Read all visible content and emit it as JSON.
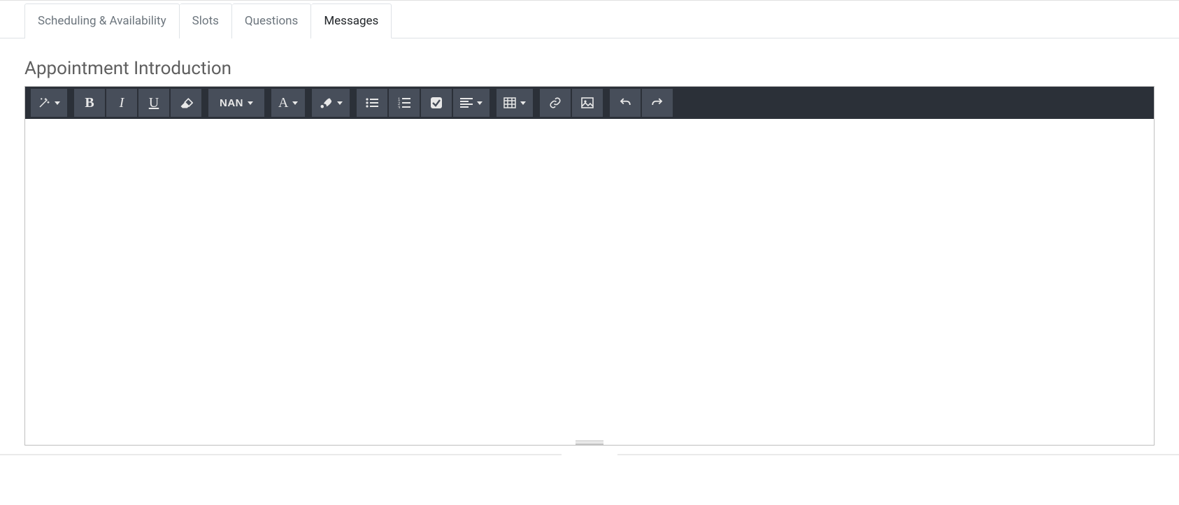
{
  "tabs": {
    "scheduling": "Scheduling & Availability",
    "slots": "Slots",
    "questions": "Questions",
    "messages": "Messages"
  },
  "section": {
    "title": "Appointment Introduction"
  },
  "toolbar": {
    "font_size_label": "NAN"
  },
  "editor": {
    "content": ""
  }
}
